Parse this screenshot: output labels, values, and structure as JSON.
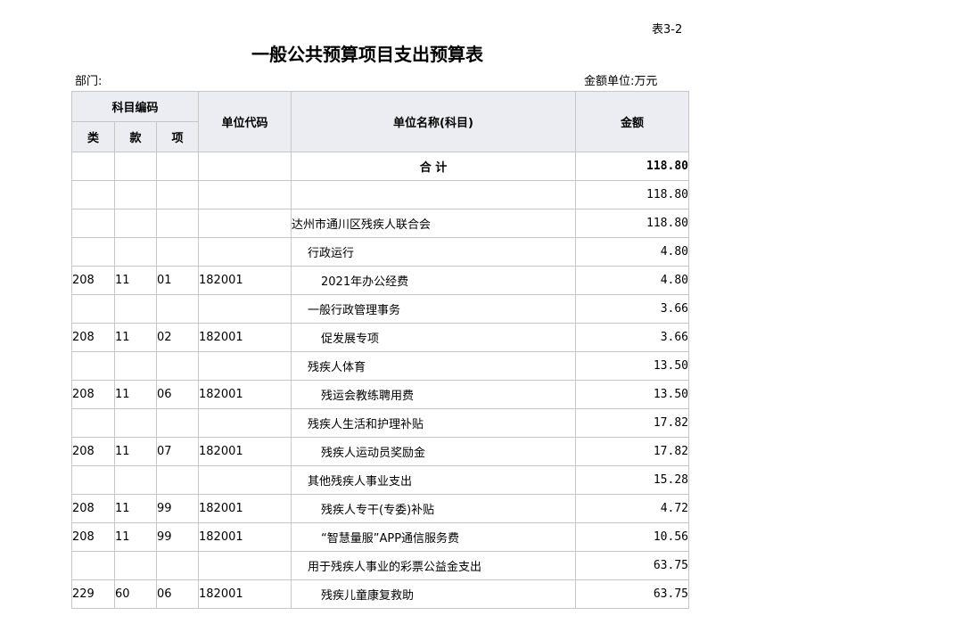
{
  "header": {
    "table_no": "表3-2",
    "title": "一般公共预算项目支出预算表",
    "dept_label": "部门:",
    "unit_label": "金额单位:万元"
  },
  "columns": {
    "subject_code": "科目编码",
    "lei": "类",
    "kuan": "款",
    "xiang": "项",
    "unit_code": "单位代码",
    "unit_name": "单位名称(科目)",
    "amount": "金额"
  },
  "rows": [
    {
      "lei": "",
      "kuan": "",
      "xiang": "",
      "code": "",
      "name": "合    计",
      "amount": "118.80",
      "level": 0,
      "total": true
    },
    {
      "lei": "",
      "kuan": "",
      "xiang": "",
      "code": "",
      "name": "",
      "amount": "118.80",
      "level": 0
    },
    {
      "lei": "",
      "kuan": "",
      "xiang": "",
      "code": "",
      "name": "达州市通川区残疾人联合会",
      "amount": "118.80",
      "level": 0
    },
    {
      "lei": "",
      "kuan": "",
      "xiang": "",
      "code": "",
      "name": "行政运行",
      "amount": "4.80",
      "level": 1
    },
    {
      "lei": "208",
      "kuan": "11",
      "xiang": "01",
      "code": "182001",
      "name": "2021年办公经费",
      "amount": "4.80",
      "level": 2
    },
    {
      "lei": "",
      "kuan": "",
      "xiang": "",
      "code": "",
      "name": "一般行政管理事务",
      "amount": "3.66",
      "level": 1
    },
    {
      "lei": "208",
      "kuan": "11",
      "xiang": "02",
      "code": "182001",
      "name": "促发展专项",
      "amount": "3.66",
      "level": 2
    },
    {
      "lei": "",
      "kuan": "",
      "xiang": "",
      "code": "",
      "name": "残疾人体育",
      "amount": "13.50",
      "level": 1
    },
    {
      "lei": "208",
      "kuan": "11",
      "xiang": "06",
      "code": "182001",
      "name": "残运会教练聘用费",
      "amount": "13.50",
      "level": 2
    },
    {
      "lei": "",
      "kuan": "",
      "xiang": "",
      "code": "",
      "name": "残疾人生活和护理补贴",
      "amount": "17.82",
      "level": 1
    },
    {
      "lei": "208",
      "kuan": "11",
      "xiang": "07",
      "code": "182001",
      "name": "残疾人运动员奖励金",
      "amount": "17.82",
      "level": 2
    },
    {
      "lei": "",
      "kuan": "",
      "xiang": "",
      "code": "",
      "name": "其他残疾人事业支出",
      "amount": "15.28",
      "level": 1
    },
    {
      "lei": "208",
      "kuan": "11",
      "xiang": "99",
      "code": "182001",
      "name": "残疾人专干(专委)补贴",
      "amount": "4.72",
      "level": 2
    },
    {
      "lei": "208",
      "kuan": "11",
      "xiang": "99",
      "code": "182001",
      "name": "“智慧量服”APP通信服务费",
      "amount": "10.56",
      "level": 2
    },
    {
      "lei": "",
      "kuan": "",
      "xiang": "",
      "code": "",
      "name": "用于残疾人事业的彩票公益金支出",
      "amount": "63.75",
      "level": 1
    },
    {
      "lei": "229",
      "kuan": "60",
      "xiang": "06",
      "code": "182001",
      "name": "残疾儿童康复救助",
      "amount": "63.75",
      "level": 2
    }
  ]
}
